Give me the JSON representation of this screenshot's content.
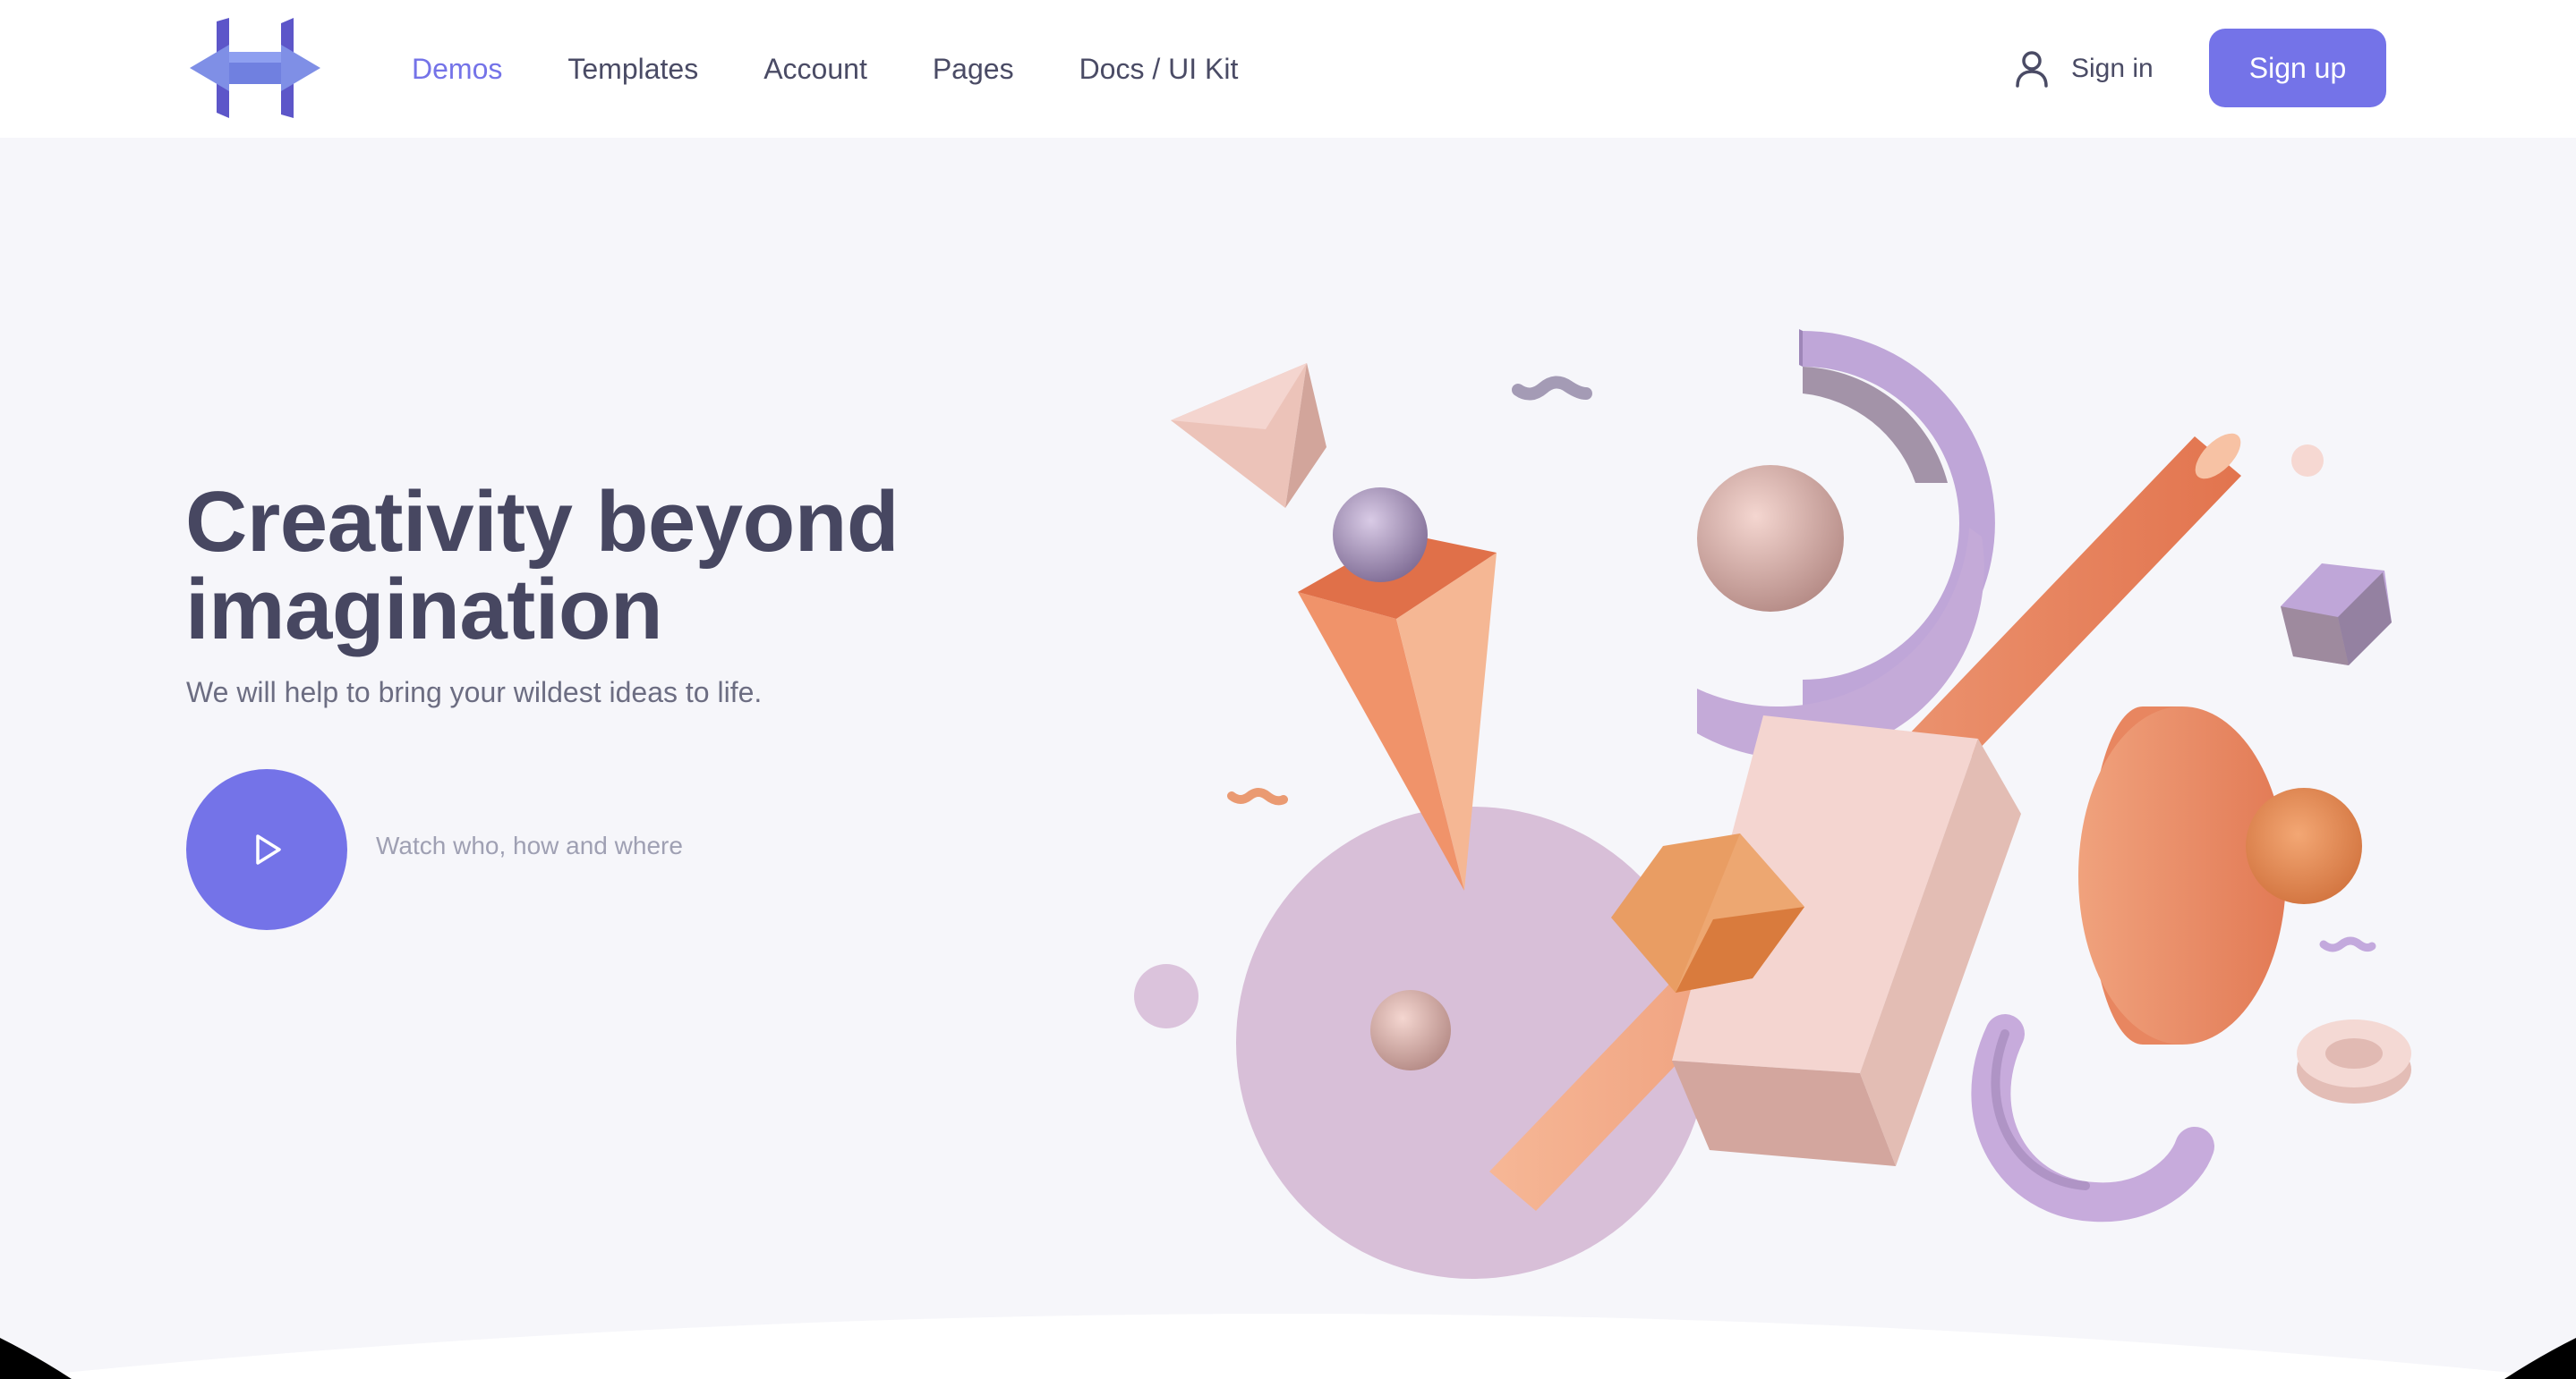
{
  "colors": {
    "accent": "#7473e8",
    "text_dark": "#474761",
    "text_muted": "#9fa0b3",
    "hero_bg": "#f6f6fa"
  },
  "header": {
    "logo_icon": "brand-logo-icon",
    "nav": [
      {
        "label": "Demos",
        "active": true
      },
      {
        "label": "Templates",
        "active": false
      },
      {
        "label": "Account",
        "active": false
      },
      {
        "label": "Pages",
        "active": false
      },
      {
        "label": "Docs / UI Kit",
        "active": false
      }
    ],
    "signin": {
      "icon": "user-icon",
      "label": "Sign in"
    },
    "signup_label": "Sign up"
  },
  "hero": {
    "title_line1": "Creativity beyond",
    "title_line2": "imagination",
    "subtitle": "We will help to bring your wildest ideas to life.",
    "play_icon": "play-icon",
    "watch_label": "Watch who, how and where"
  }
}
